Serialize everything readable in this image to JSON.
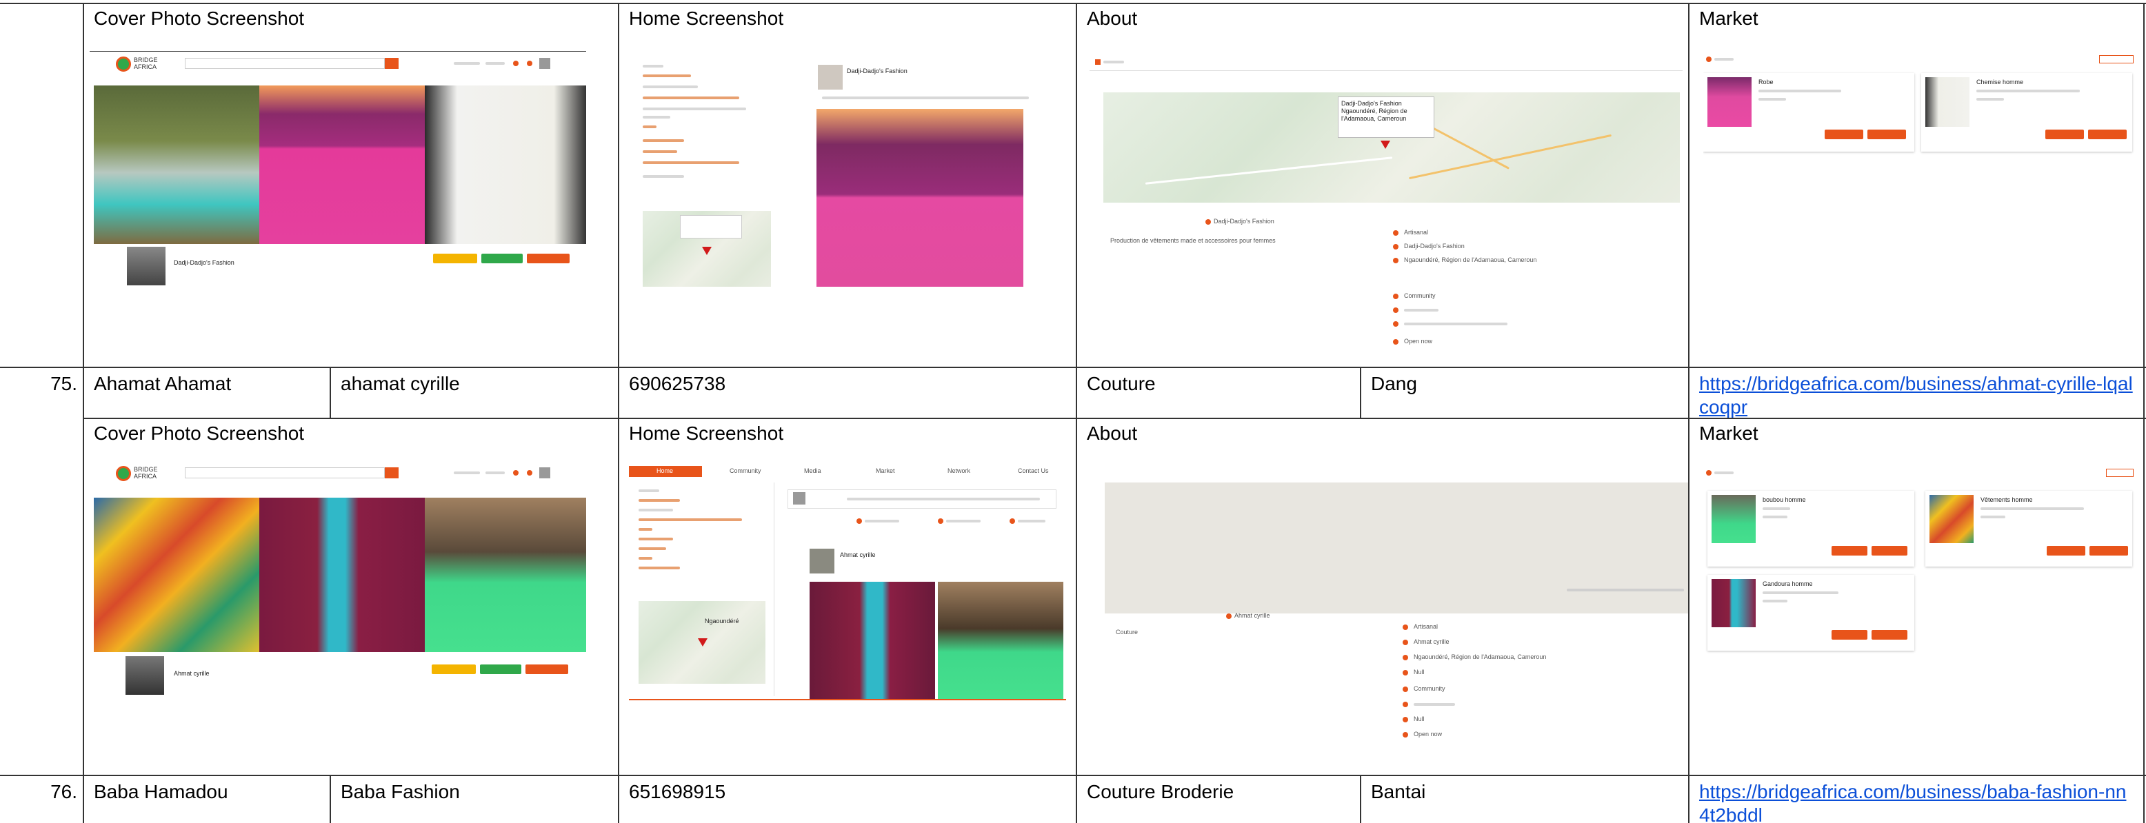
{
  "headers": {
    "cover": "Cover Photo Screenshot",
    "home": "Home Screenshot",
    "about": "About",
    "market": "Market"
  },
  "rows": [
    {
      "num": "75.",
      "name": "Ahamat Ahamat",
      "business": "ahamat cyrille",
      "phone": "690625738",
      "category": "Couture",
      "location": "Dang",
      "url": "https://bridgeafrica.com/business/ahmat-cyrille-lqalcoqpr"
    },
    {
      "num": "76.",
      "name": "Baba Hamadou",
      "business": "Baba Fashion",
      "phone": "651698915",
      "category": "Couture Broderie",
      "location": "Bantai",
      "url": "https://bridgeafrica.com/business/baba-fashion-nn4t2bddl"
    }
  ],
  "shots": {
    "logo_line1": "BRIDGE",
    "logo_line2": "AFRICA",
    "block1": {
      "profile_name": "Dadji-Dadjo's Fashion",
      "home_page_name": "Dadji-Dadjo's Fashion",
      "map_popup": "Dadji-Dadjo's Fashion Ngaoundéré, Région de l'Adamaoua, Cameroun",
      "about_name": "Dadji-Dadjo's Fashion",
      "about_desc": "Production de vêtements made et accessoires pour femmes",
      "about_items": [
        "Artisanal",
        "Dadji-Dadjo's Fashion",
        "Ngaoundéré, Région de l'Adamaoua, Cameroun",
        "Community",
        "Open now"
      ],
      "market_items": [
        "Robe",
        "Chemise homme"
      ]
    },
    "block2": {
      "profile_name": "Ahmat cyrille",
      "home_page_name": "Ahmat cyrille",
      "home_tabs": [
        "Home",
        "Community",
        "Media",
        "Market",
        "Network",
        "Contact Us"
      ],
      "map_label": "Ngaoundéré",
      "about_name": "Ahmat cyrille",
      "about_desc": "Couture",
      "about_items": [
        "Artisanal",
        "Ahmat cyrille",
        "Ngaoundéré, Région de l'Adamaoua, Cameroun",
        "Null",
        "Community",
        "Null",
        "Open now"
      ],
      "market_items": [
        "boubou homme",
        "Vêtements homme",
        "Gandoura homme"
      ]
    },
    "colors": {
      "accent": "#e8541a",
      "green": "#2fa84a",
      "yellow": "#f4b400",
      "link": "#0b4fd8"
    }
  }
}
